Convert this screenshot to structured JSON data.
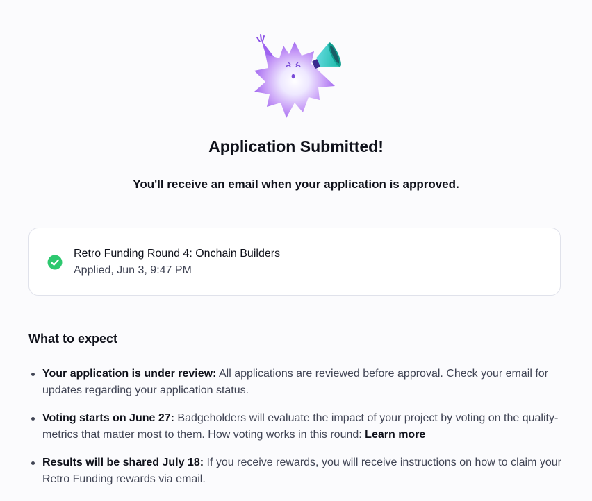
{
  "header": {
    "illustration": "sunny-mascot-megaphone-illustration",
    "title": "Application Submitted!",
    "subtitle": "You'll receive an email when your application is approved."
  },
  "application": {
    "status_icon": "check-circle-icon",
    "status_color": "#2dc86f",
    "round_name": "Retro Funding Round 4: Onchain Builders",
    "applied_at": "Applied, Jun 3, 9:47 PM"
  },
  "expectations": {
    "heading": "What to expect",
    "items": [
      {
        "title": "Your application is under review:",
        "text": " All applications are reviewed before approval. Check your email for updates regarding your application status."
      },
      {
        "title": "Voting starts on June 27:",
        "text": " Badgeholders will evaluate the impact of your project by voting on the quality-metrics that matter most to them. How voting works in this round: ",
        "link": "Learn more"
      },
      {
        "title": "Results will be shared July 18:",
        "text": " If you receive rewards, you will receive instructions on how to claim your Retro Funding rewards via email."
      }
    ]
  },
  "colors": {
    "background": "#fbfbfd",
    "card_border": "#e0e2eb",
    "text_primary": "#0f111a",
    "text_secondary": "#404454",
    "mascot_purple": "#b27cf5",
    "megaphone_teal": "#2fd6c2"
  }
}
